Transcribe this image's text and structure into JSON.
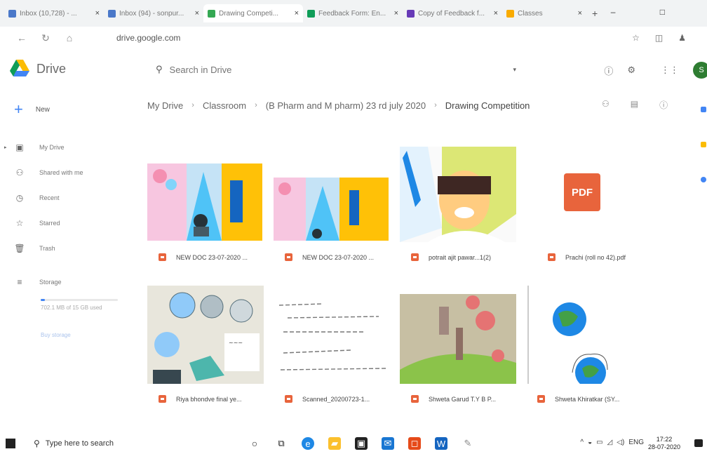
{
  "tabs": [
    {
      "label": "Inbox (10,728) - ...",
      "color": "#4a78c9"
    },
    {
      "label": "Inbox (94) - sonpur...",
      "color": "#4a78c9"
    },
    {
      "label": "Drawing Competi...",
      "color": "#34a853",
      "active": true
    },
    {
      "label": "Feedback Form: En...",
      "color": "#0f9d58"
    },
    {
      "label": "Copy of Feedback f...",
      "color": "#673ab7"
    },
    {
      "label": "Classes",
      "color": "#f9ab00"
    }
  ],
  "address": {
    "url": "drive.google.com"
  },
  "drive": {
    "brand": "Drive",
    "search_placeholder": "Search in Drive",
    "avatar_letter": "S"
  },
  "sidebar": {
    "new_label": "New",
    "items": [
      {
        "label": "My Drive",
        "icon": "my-drive-icon"
      },
      {
        "label": "Shared with me",
        "icon": "shared-icon"
      },
      {
        "label": "Recent",
        "icon": "clock-icon"
      },
      {
        "label": "Starred",
        "icon": "star-icon"
      },
      {
        "label": "Trash",
        "icon": "trash-icon"
      }
    ],
    "storage_label": "Storage",
    "storage_text": "702.1 MB of 15 GB used",
    "storage_fraction": 0.05,
    "buy_storage": "Buy storage"
  },
  "breadcrumb": [
    "My Drive",
    "Classroom",
    "(B Pharm and M pharm) 23 rd july 2020",
    "Drawing Competition"
  ],
  "files": [
    {
      "name": "NEW DOC 23-07-2020 ...",
      "type": "pdf"
    },
    {
      "name": "NEW DOC 23-07-2020 ...",
      "type": "pdf"
    },
    {
      "name": "potrait ajit pawar...1(2)",
      "type": "pdf"
    },
    {
      "name": "Prachi (roll no 42).pdf",
      "type": "pdf"
    },
    {
      "name": "Riya bhondve final ye...",
      "type": "pdf"
    },
    {
      "name": "Scanned_20200723-1...",
      "type": "pdf"
    },
    {
      "name": "Shweta Garud T.Y B P...",
      "type": "pdf"
    },
    {
      "name": "Shweta Khiratkar (SY...",
      "type": "pdf"
    }
  ],
  "pdf_badge": "PDF",
  "taskbar": {
    "search_placeholder": "Type here to search",
    "language": "ENG",
    "time": "17:22",
    "date": "28-07-2020"
  }
}
